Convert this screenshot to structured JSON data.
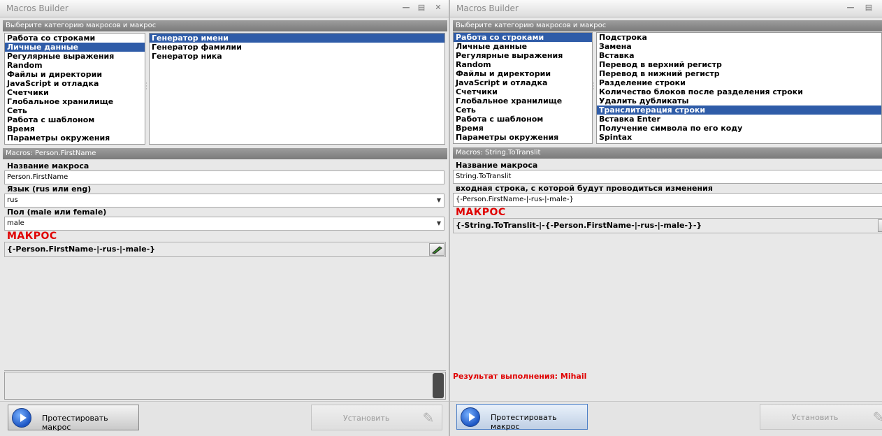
{
  "left": {
    "window_title": "Macros Builder",
    "category_header": "Выберите категорию макросов и макрос",
    "categories": [
      "Работа со строками",
      "Личные данные",
      "Регулярные выражения",
      "Random",
      "Файлы и директории",
      "JavaScript и отладка",
      "Счетчики",
      "Глобальное хранилище",
      "Сеть",
      "Работа с шаблоном",
      "Время",
      "Параметры окружения"
    ],
    "selected_category_index": 1,
    "macros": [
      "Генератор имени",
      "Генератор фамилии",
      "Генератор ника"
    ],
    "selected_macro_index": 0,
    "macros_header": "Macros: Person.FirstName",
    "fields": [
      {
        "label": "Название макроса",
        "value": "Person.FirstName",
        "type": "text"
      },
      {
        "label": "Язык (rus или eng)",
        "value": "rus",
        "type": "combo"
      },
      {
        "label": "Пол (male или female)",
        "value": "male",
        "type": "combo"
      }
    ],
    "macro_title": "МАКРОС",
    "macro_text": "{-Person.FirstName-|-rus-|-male-}",
    "result": "",
    "test_button": "Протестировать макрос",
    "install_button": "Установить"
  },
  "right": {
    "window_title": "Macros Builder",
    "category_header": "Выберите категорию макросов и макрос",
    "categories": [
      "Работа со строками",
      "Личные данные",
      "Регулярные выражения",
      "Random",
      "Файлы и директории",
      "JavaScript и отладка",
      "Счетчики",
      "Глобальное хранилище",
      "Сеть",
      "Работа с шаблоном",
      "Время",
      "Параметры окружения"
    ],
    "selected_category_index": 0,
    "macros": [
      "Подстрока",
      "Замена",
      "Вставка",
      "Перевод в верхний регистр",
      "Перевод в нижний регистр",
      "Разделение строки",
      "Количество блоков после разделения строки",
      "Удалить дубликаты",
      "Транслитерация строки",
      "Вставка Enter",
      "Получение символа по его коду",
      "Spintax"
    ],
    "selected_macro_index": 8,
    "macros_header": "Macros: String.ToTranslit",
    "fields": [
      {
        "label": "Название макроса",
        "value": "String.ToTranslit",
        "type": "text"
      },
      {
        "label": "входная строка, с которой будут проводиться изменения",
        "value": "{-Person.FirstName-|-rus-|-male-}",
        "type": "text"
      }
    ],
    "macro_title": "МАКРОС",
    "macro_text": "{-String.ToTranslit-|-{-Person.FirstName-|-rus-|-male-}-}",
    "result": "Результат выполнения: Mihail",
    "test_button": "Протестировать макрос",
    "install_button": "Установить"
  }
}
